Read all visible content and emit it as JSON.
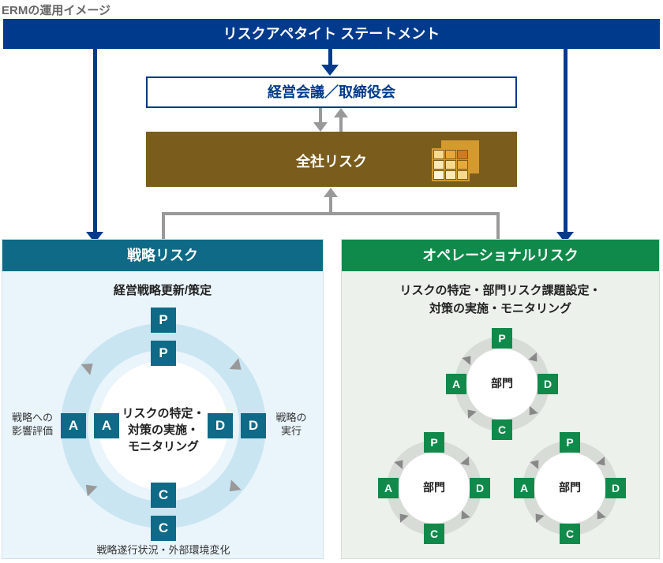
{
  "title": "ERMの運用イメージ",
  "top_banner": "リスクアペタイト ステートメント",
  "management_box": "経営会議／取締役会",
  "corporate_risk": "全社リスク",
  "left": {
    "header": "戦略リスク",
    "p_label": "経営戦略更新/策定",
    "d_label": "戦略の\n実行",
    "c_label": "戦略遂行状況・外部環境変化",
    "a_label": "戦略への\n影響評価",
    "center": "リスクの特定・\n対策の実施・\nモニタリング",
    "P": "P",
    "D": "D",
    "C": "C",
    "A": "A"
  },
  "right": {
    "header": "オペレーショナルリスク",
    "sub": "リスクの特定・部門リスク課題設定・\n対策の実施・モニタリング",
    "unit": "部門",
    "P": "P",
    "D": "D",
    "C": "C",
    "A": "A"
  }
}
